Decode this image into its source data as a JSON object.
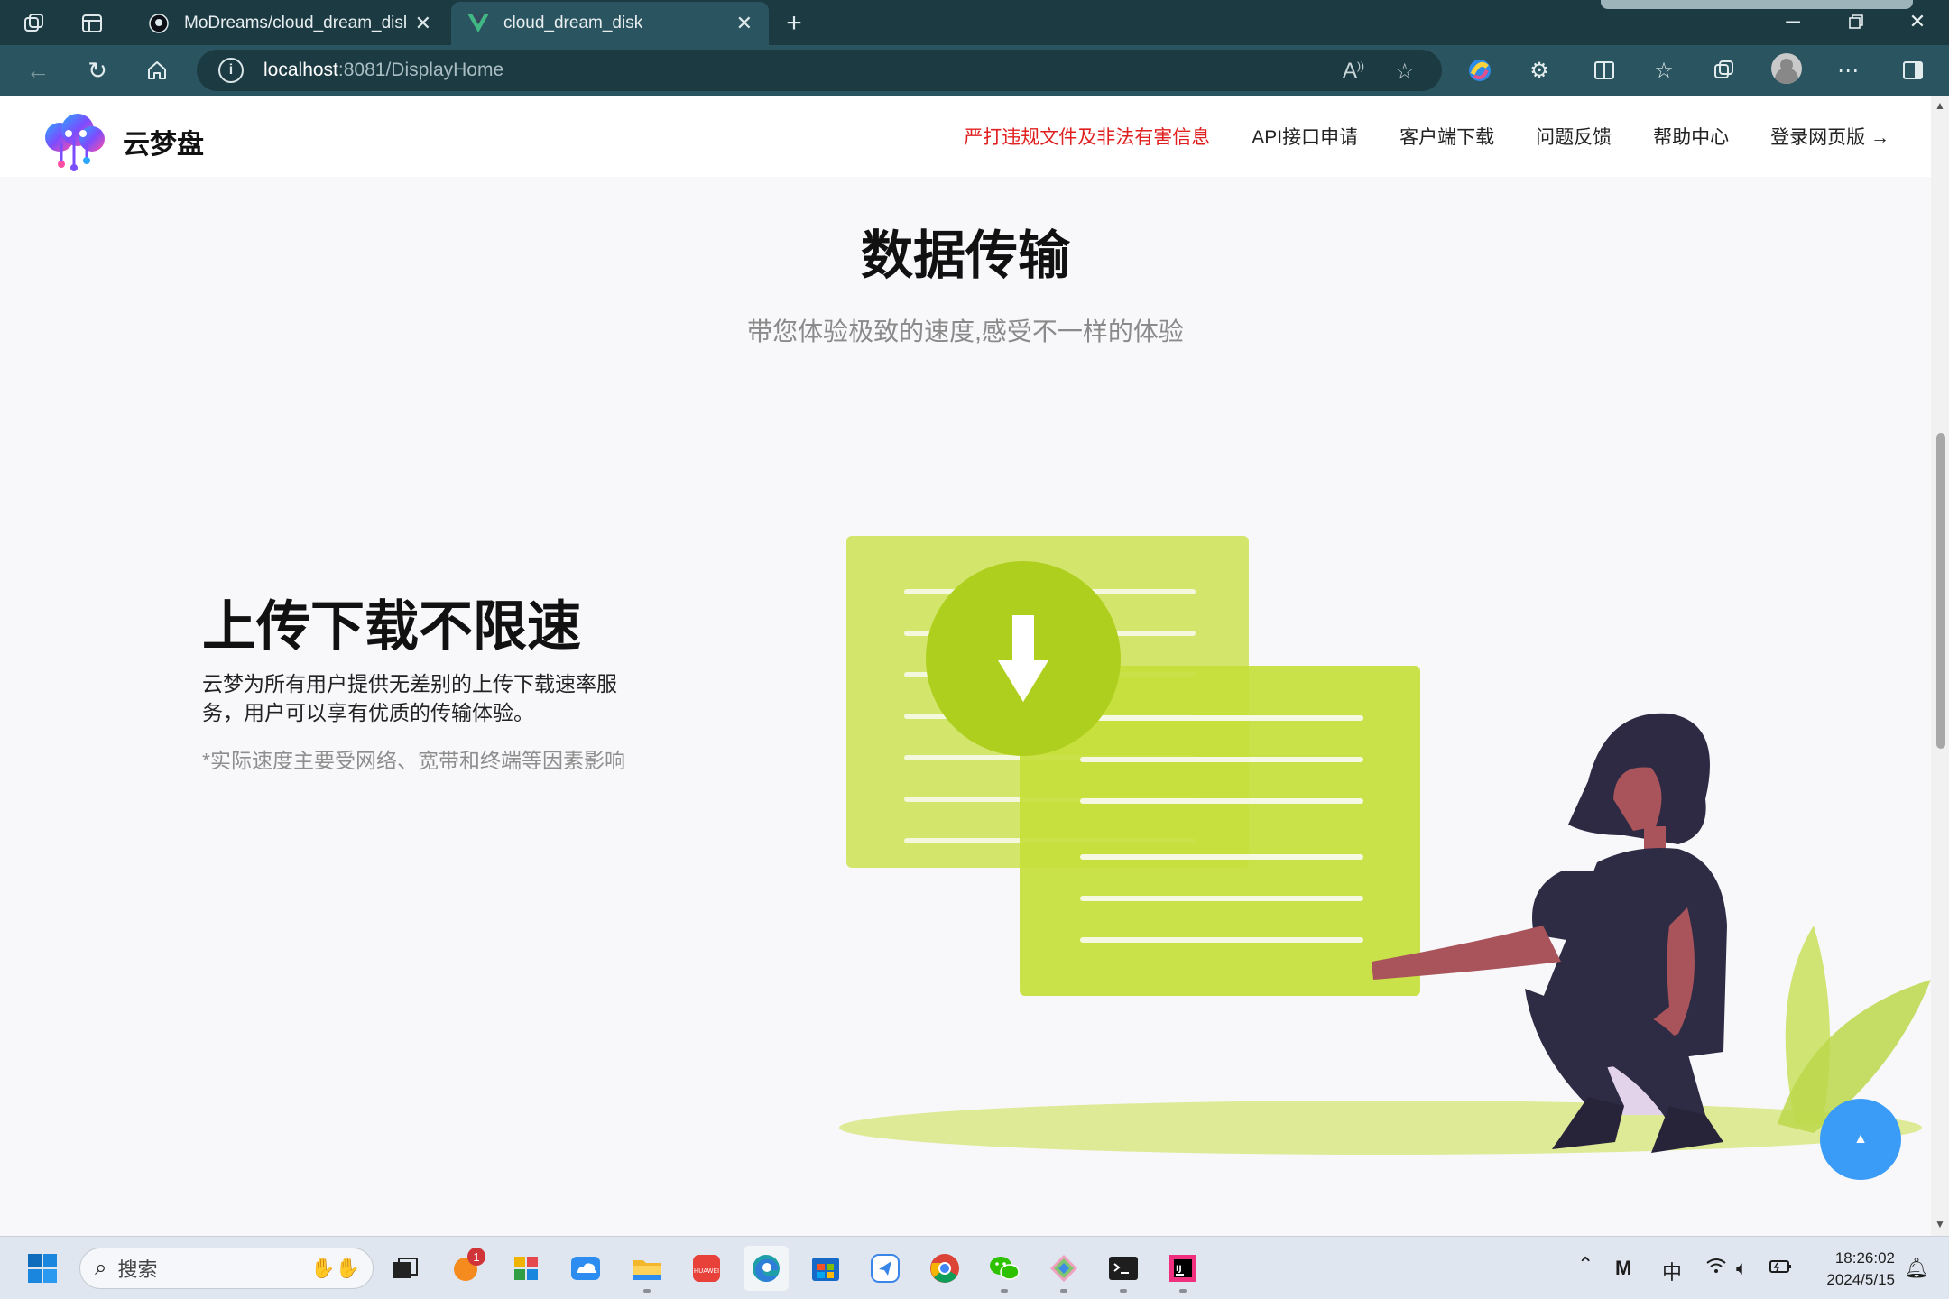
{
  "browser": {
    "tabs": [
      {
        "title": "MoDreams/cloud_dream_disk: —",
        "favicon": "github-icon"
      },
      {
        "title": "cloud_dream_disk",
        "favicon": "vue-icon"
      }
    ],
    "url_host": "localhost",
    "url_rest": ":8081/DisplayHome"
  },
  "site": {
    "logo_text": "云梦盘",
    "nav": {
      "warning": "严打违规文件及非法有害信息",
      "api": "API接口申请",
      "client": "客户端下载",
      "feedback": "问题反馈",
      "help": "帮助中心",
      "login": "登录网页版 →"
    },
    "hero": {
      "title": "数据传输",
      "subtitle": "带您体验极致的速度,感受不一样的体验"
    },
    "feature": {
      "title": "上传下载不限速",
      "description": "云梦为所有用户提供无差别的上传下载速率服务，用户可以享有优质的传输体验。",
      "note": "*实际速度主要受网络、宽带和终端等因素影响"
    },
    "colors": {
      "accent": "#3a9cf6",
      "warning": "#e02020",
      "illustration": "#c5df3a"
    }
  },
  "taskbar": {
    "search_placeholder": "搜索",
    "notification_badge": "1",
    "ime": "中",
    "time": "18:26:02",
    "date": "2024/5/15"
  }
}
